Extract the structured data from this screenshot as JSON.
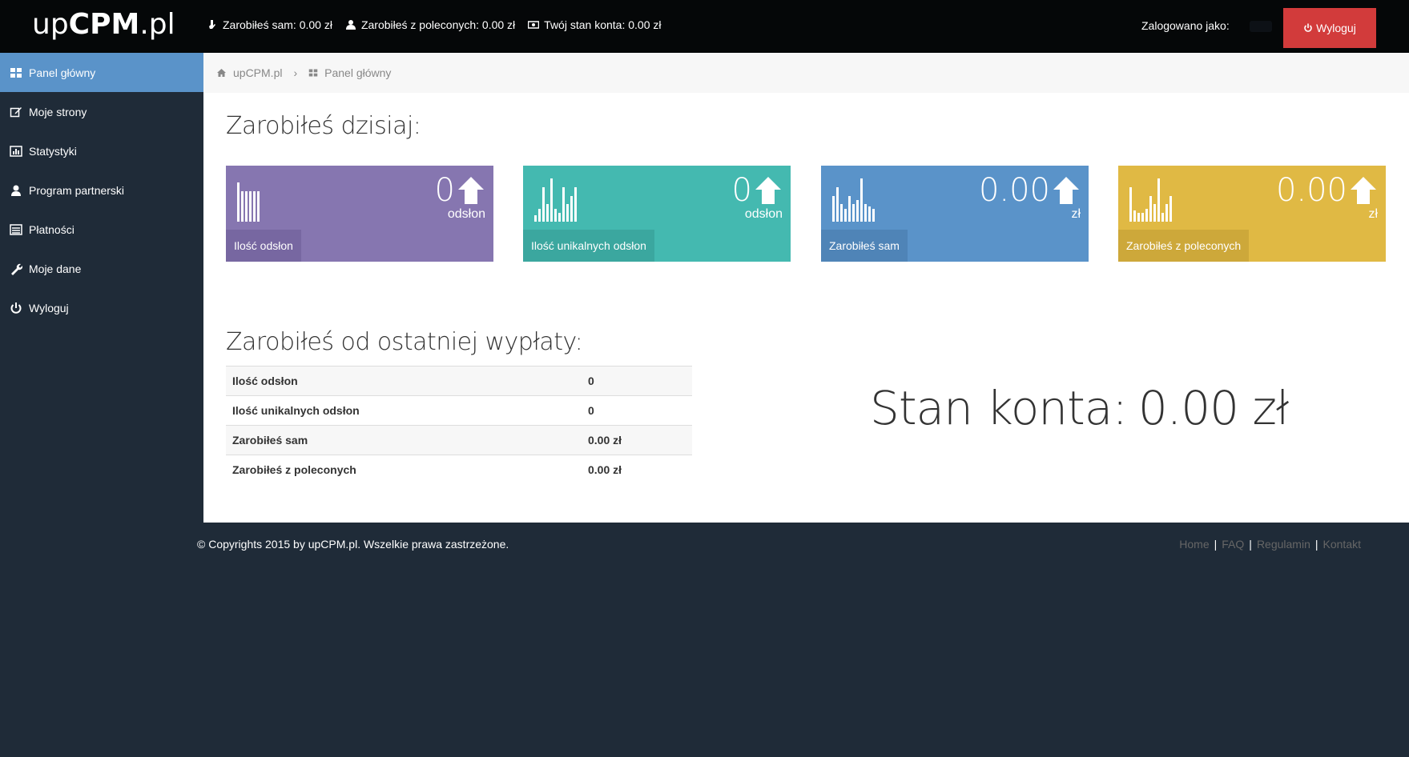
{
  "header": {
    "logo_light_prefix": "up",
    "logo_bold": "CPM",
    "logo_light_suffix": ".pl",
    "stats": [
      {
        "icon": "hand-icon",
        "text": "Zarobiłeś sam: 0.00 zł"
      },
      {
        "icon": "user-icon",
        "text": "Zarobiłeś z poleconych: 0.00 zł"
      },
      {
        "icon": "money-icon",
        "text": "Twój stan konta: 0.00 zł"
      }
    ],
    "logged_in_label": "Zalogowano jako:",
    "logout_label": "Wyloguj"
  },
  "sidebar": {
    "items": [
      {
        "label": "Panel główny",
        "icon": "dashboard-icon",
        "active": true
      },
      {
        "label": "Moje strony",
        "icon": "edit-icon"
      },
      {
        "label": "Statystyki",
        "icon": "chart-icon"
      },
      {
        "label": "Program partnerski",
        "icon": "user-icon"
      },
      {
        "label": "Płatności",
        "icon": "list-icon"
      },
      {
        "label": "Moje dane",
        "icon": "wrench-icon"
      },
      {
        "label": "Wyloguj",
        "icon": "power-icon"
      }
    ]
  },
  "breadcrumb": {
    "home": "upCPM.pl",
    "current": "Panel główny"
  },
  "today": {
    "title": "Zarobiłeś dzisiaj:",
    "tiles": [
      {
        "value": "0",
        "unit": "odsłon",
        "label": "Ilość odsłon",
        "color": "#8676b0",
        "spark": [
          0.9,
          0.7,
          0.7,
          0.7,
          0.7,
          0.7
        ]
      },
      {
        "value": "0",
        "unit": "odsłon",
        "label": "Ilość unikalnych odsłon",
        "color": "#44b9b0",
        "spark": [
          0.15,
          0.3,
          0.8,
          0.4,
          1.0,
          0.3,
          0.2,
          0.8,
          0.4,
          0.6,
          0.8
        ]
      },
      {
        "value": "0.00",
        "unit": "zł",
        "label": "Zarobiłeś sam",
        "color": "#5a93c9",
        "spark": [
          0.6,
          0.8,
          0.4,
          0.3,
          0.6,
          0.4,
          0.5,
          1.0,
          0.4,
          0.35,
          0.3
        ]
      },
      {
        "value": "0.00",
        "unit": "zł",
        "label": "Zarobiłeś z poleconych",
        "color": "#e0b944",
        "spark": [
          0.8,
          0.25,
          0.2,
          0.2,
          0.3,
          0.6,
          0.4,
          1.0,
          0.2,
          0.4,
          0.6
        ]
      }
    ]
  },
  "since_payout": {
    "title": "Zarobiłeś od ostatniej wypłaty:",
    "rows": [
      {
        "label": "Ilość odsłon",
        "value": "0"
      },
      {
        "label": "Ilość unikalnych odsłon",
        "value": "0"
      },
      {
        "label": "Zarobiłeś sam",
        "value": "0.00 zł"
      },
      {
        "label": "Zarobiłeś z poleconych",
        "value": "0.00 zł"
      }
    ]
  },
  "balance": {
    "label": "Stan konta:",
    "value": "0.00 zł"
  },
  "footer": {
    "copyright": "© Copyrights 2015 by upCPM.pl. Wszelkie prawa zastrzeżone.",
    "links": [
      "Home",
      "FAQ",
      "Regulamin",
      "Kontakt"
    ]
  }
}
